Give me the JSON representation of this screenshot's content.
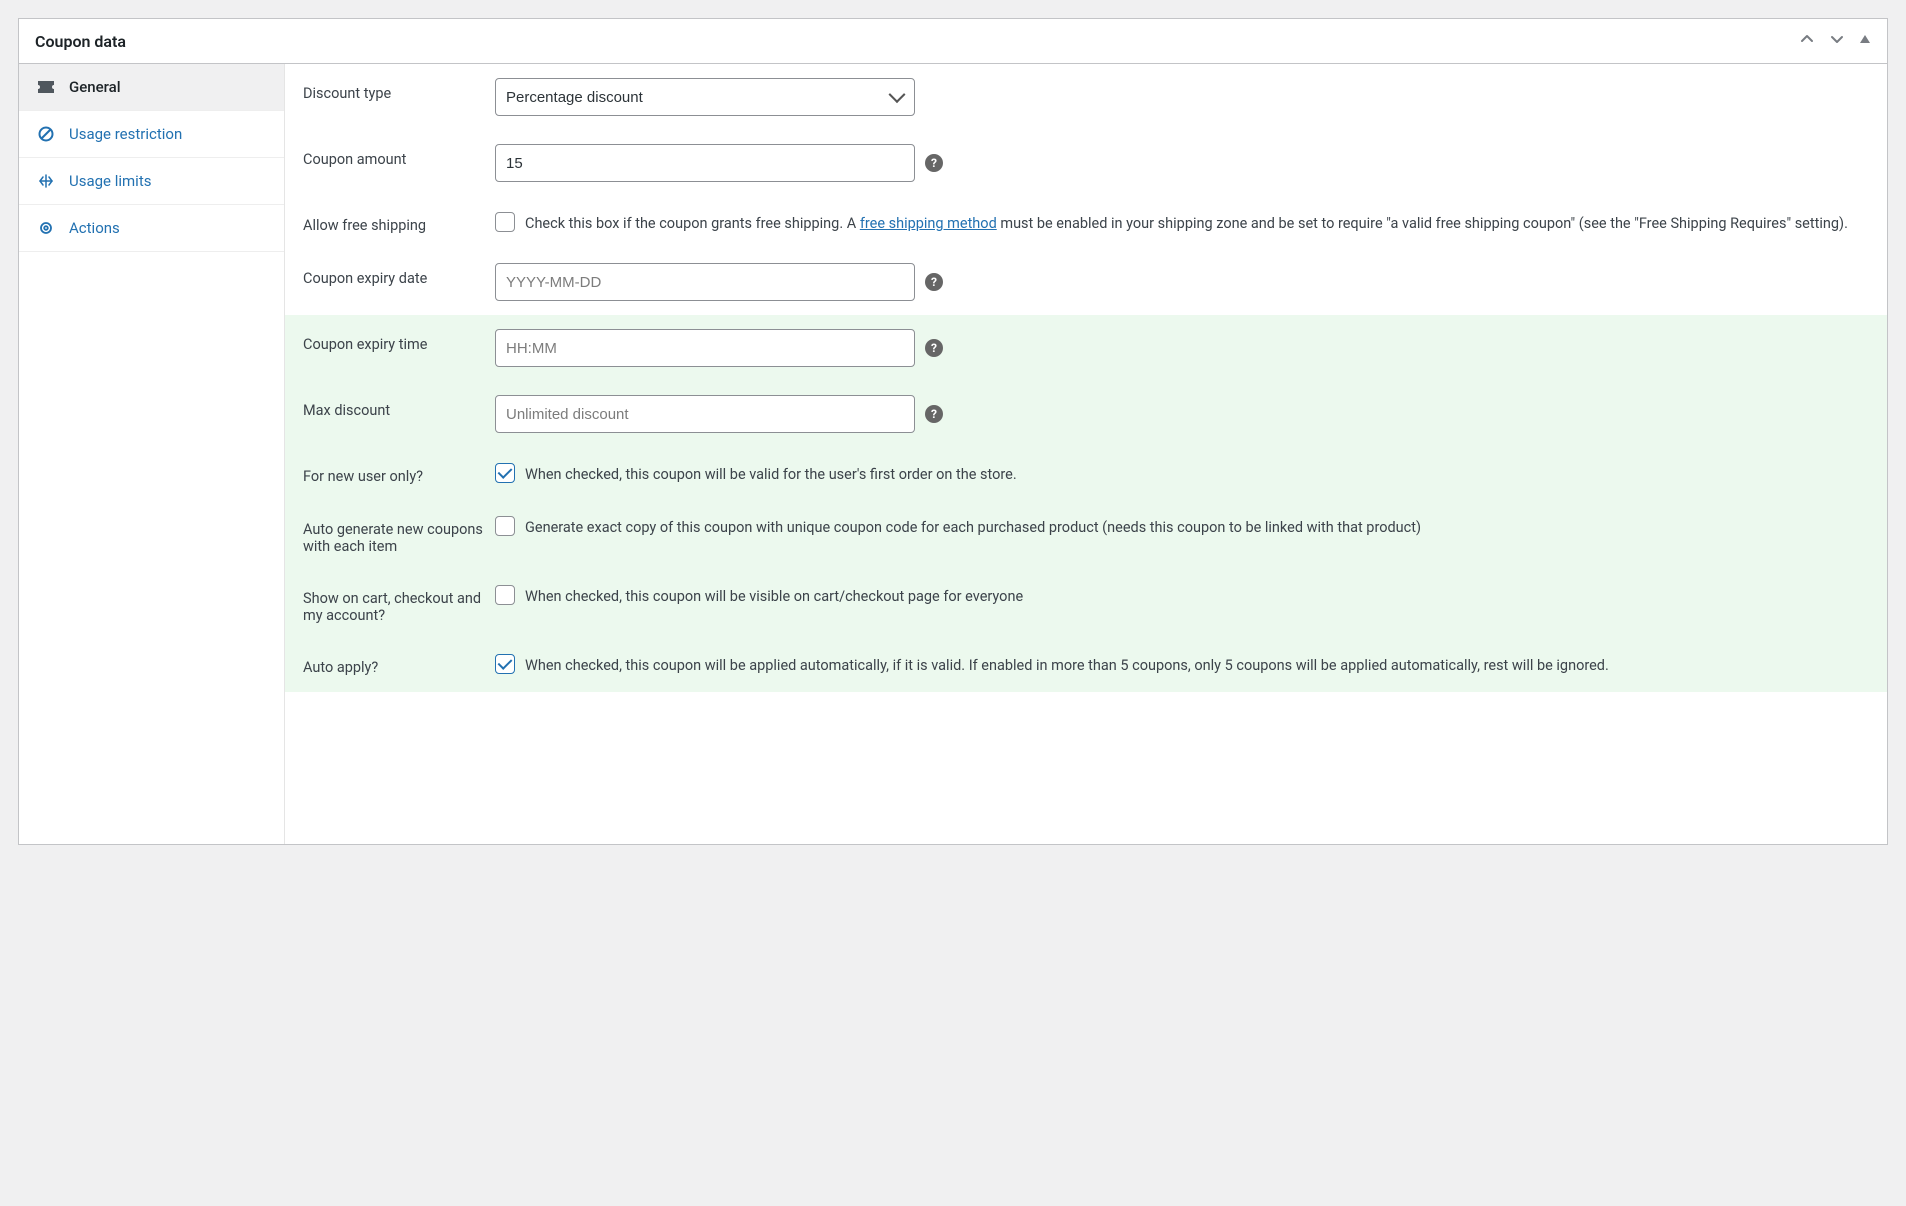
{
  "panel": {
    "title": "Coupon data"
  },
  "tabs": {
    "general": "General",
    "usage_restriction": "Usage restriction",
    "usage_limits": "Usage limits",
    "actions": "Actions"
  },
  "labels": {
    "discount_type": "Discount type",
    "coupon_amount": "Coupon amount",
    "allow_free_shipping": "Allow free shipping",
    "coupon_expiry_date": "Coupon expiry date",
    "coupon_expiry_time": "Coupon expiry time",
    "max_discount": "Max discount",
    "for_new_user": "For new user only?",
    "auto_generate": "Auto generate new coupons with each item",
    "show_on_cart": "Show on cart, checkout and my account?",
    "auto_apply": "Auto apply?"
  },
  "fields": {
    "discount_type_value": "Percentage discount",
    "coupon_amount_value": "15",
    "expiry_date_placeholder": "YYYY-MM-DD",
    "expiry_time_placeholder": "HH:MM",
    "max_discount_placeholder": "Unlimited discount"
  },
  "descriptions": {
    "free_shipping_pre": "Check this box if the coupon grants free shipping. A ",
    "free_shipping_link": "free shipping method",
    "free_shipping_post": " must be enabled in your shipping zone and be set to require \"a valid free shipping coupon\" (see the \"Free Shipping Requires\" setting).",
    "for_new_user": "When checked, this coupon will be valid for the user's first order on the store.",
    "auto_generate": "Generate exact copy of this coupon with unique coupon code for each purchased product (needs this coupon to be linked with that product)",
    "show_on_cart": "When checked, this coupon will be visible on cart/checkout page for everyone",
    "auto_apply": "When checked, this coupon will be applied automatically, if it is valid. If enabled in more than 5 coupons, only 5 coupons will be applied automatically, rest will be ignored."
  },
  "checks": {
    "allow_free_shipping": false,
    "for_new_user": true,
    "auto_generate": false,
    "show_on_cart": false,
    "auto_apply": true
  }
}
